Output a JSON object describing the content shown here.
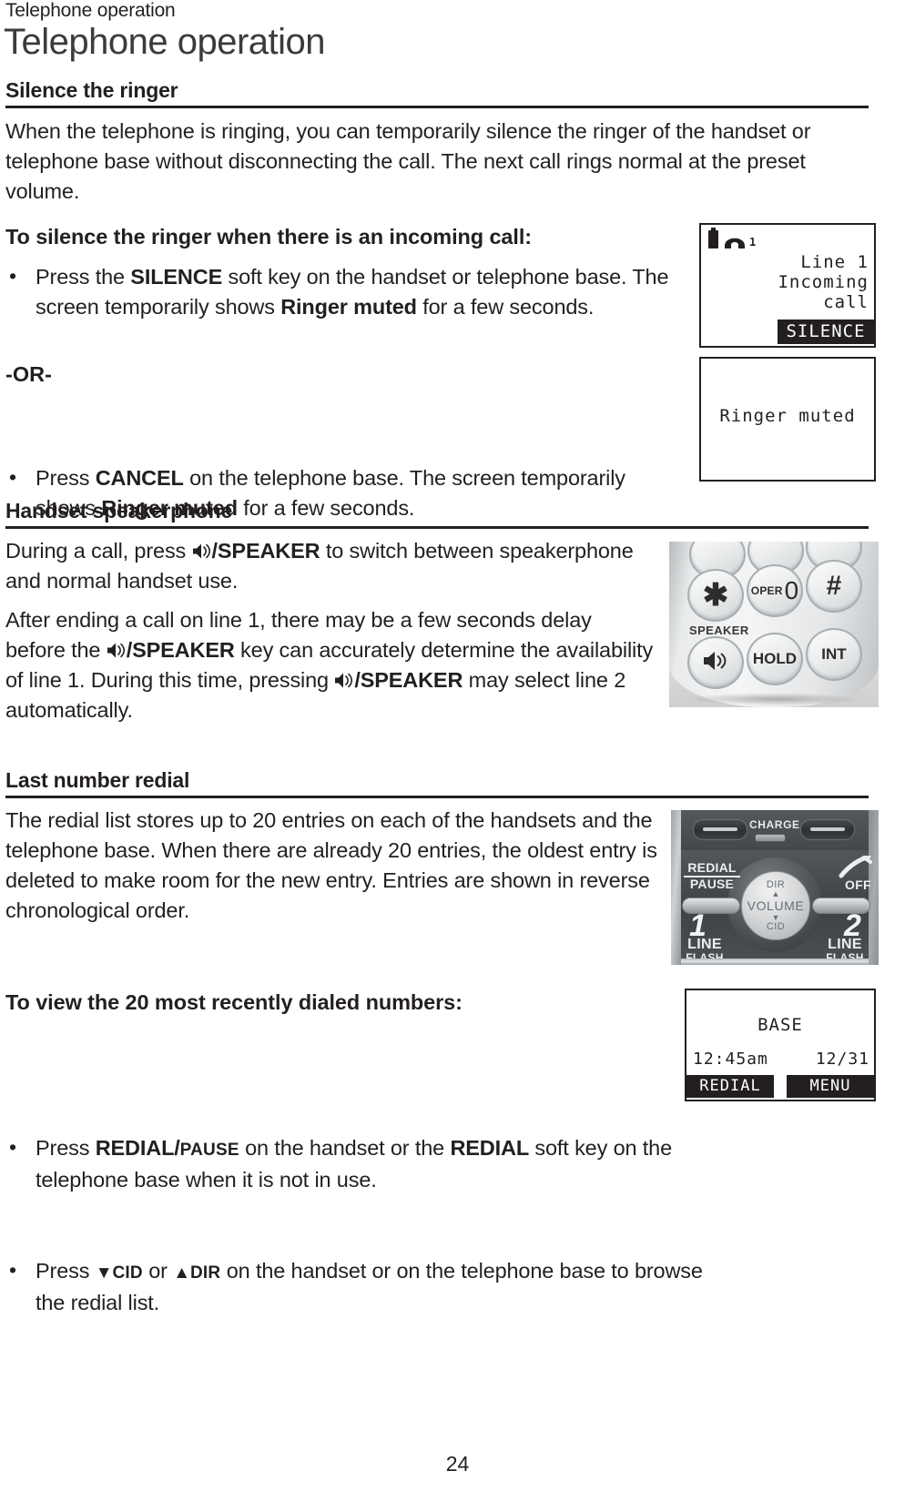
{
  "header": {
    "running_head": "Telephone operation",
    "title": "Telephone operation"
  },
  "sections": [
    {
      "heading": "Silence the ringer",
      "paragraph": "When the telephone is ringing, you can temporarily silence the ringer of the handset or telephone base without disconnecting the call. The next call rings normal at the preset volume.",
      "lead": "To silence the ringer when there is an incoming call:",
      "bullet1": {
        "t1": "Press the ",
        "b1": "SILENCE",
        "t2": " soft key on the handset or telephone base. The screen temporarily shows ",
        "b2": "Ringer muted",
        "t3": " for a few seconds."
      },
      "or_label": "-OR-",
      "bullet2": {
        "t1": "Press ",
        "b1": "CANCEL",
        "t2": " on the telephone base. The screen temporarily shows ",
        "b2": "Ringer muted",
        "t3": " for a few seconds."
      }
    },
    {
      "heading": "Handset speakerphone",
      "paragraph1": {
        "t1": "During a call, press ",
        "icon": "speaker-icon",
        "b1": "/SPEAKER",
        "t2": " to switch between speakerphone and normal handset use."
      },
      "paragraph2": {
        "t1": "After ending a call on line 1, there may be a few seconds delay before the ",
        "b1": "/SPEAKER",
        "t2": " key can accurately determine the availability of line 1. During this time, pressing ",
        "b2": "/SPEAKER",
        "t3": " may select line 2 automatically."
      }
    },
    {
      "heading": "Last number redial",
      "paragraph": "The redial list stores up to 20 entries on each of the handsets and the telephone base. When there are already 20 entries, the oldest entry is deleted to make room for the new entry. Entries are shown in reverse chronological order.",
      "lead": "To view the 20 most recently dialed numbers:",
      "bullet1": {
        "t1": "Press ",
        "b1": "REDIAL/",
        "b1sc": "PAUSE",
        "t2": " on the handset or the ",
        "b2": "REDIAL",
        "t3": " soft key on the telephone base when it is not in use."
      },
      "bullet2": {
        "t1": "Press ",
        "tri_down": "▼",
        "b1": "CID",
        "t2": " or ",
        "tri_up": "▲",
        "b2": "DIR",
        "t3": " on the handset or on the telephone base to browse the redial list."
      }
    }
  ],
  "lcd_incoming": {
    "icons": {
      "battery": "battery-icon",
      "handset": "handset-icon",
      "handset_number": "1"
    },
    "line1": "Line 1",
    "line2": "Incoming",
    "line3": "call",
    "softkey_right": "SILENCE"
  },
  "lcd_ringer_muted": {
    "message": "Ringer muted"
  },
  "lcd_base": {
    "title": "BASE",
    "time": "12:45am",
    "date": "12/31",
    "softkey_left": "REDIAL",
    "softkey_right": "MENU"
  },
  "handset_photo": {
    "keys": {
      "star": "✱",
      "oper_prefix": "OPER",
      "zero": "0",
      "hash": "#",
      "speaker_label": "SPEAKER",
      "speaker_icon": "speaker-icon",
      "hold": "HOLD",
      "int": "INT"
    }
  },
  "base_photo": {
    "charge_label": "CHARGE",
    "redial_top": "REDIAL",
    "redial_bottom": "PAUSE",
    "off_label": "OFF",
    "wheel": {
      "up_label": "DIR",
      "up_arrow": "▲",
      "center_label": "VOLUME",
      "down_arrow": "▼",
      "down_label": "CID"
    },
    "line1_num": "1",
    "line1_top": "LINE",
    "line1_bottom": "FLASH",
    "line2_num": "2",
    "line2_top": "LINE",
    "line2_bottom": "FLASH"
  },
  "footer": {
    "page_number": "24"
  },
  "colors": {
    "ink": "#231f20",
    "title_grey": "#3b3b3b"
  }
}
